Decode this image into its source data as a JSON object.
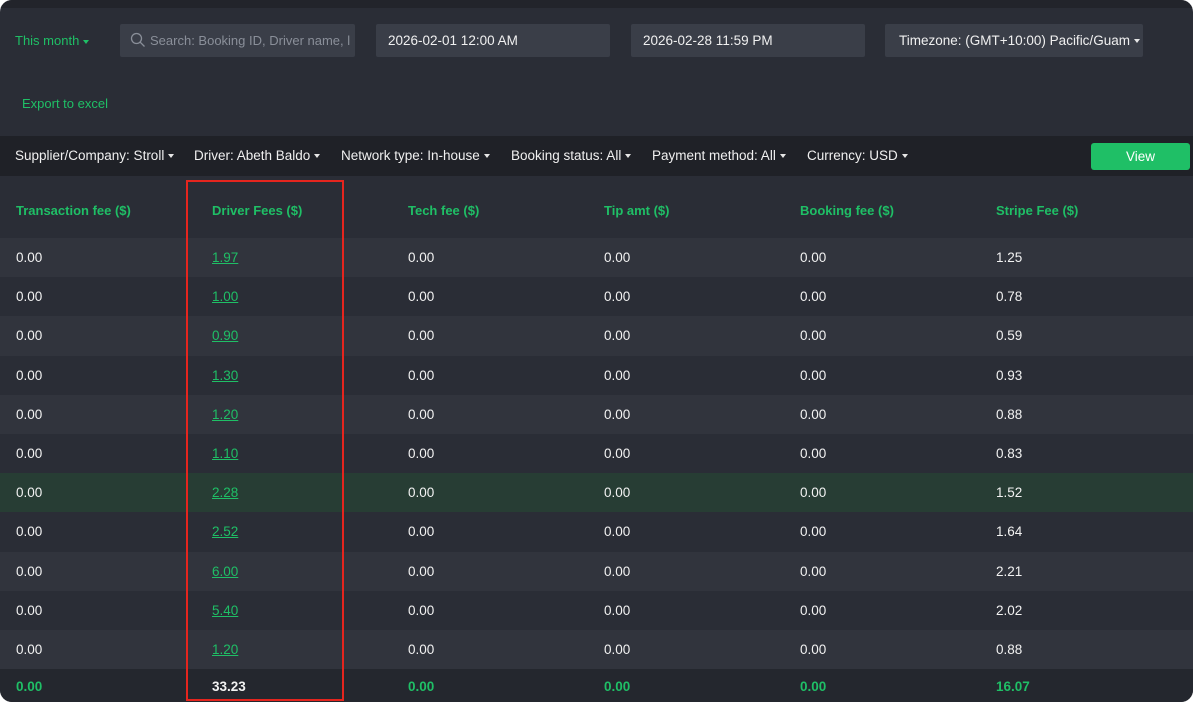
{
  "filters": {
    "period": "This month",
    "search_placeholder": "Search: Booking ID, Driver name, l",
    "start_date": "2026-02-01 12:00 AM",
    "end_date": "2026-02-28 11:59 PM",
    "timezone": "Timezone: (GMT+10:00) Pacific/Guam",
    "export_label": "Export to excel"
  },
  "filter_bar": {
    "supplier": "Supplier/Company: Stroll",
    "driver": "Driver: Abeth Baldo",
    "network": "Network type: In-house",
    "booking_status": "Booking status: All",
    "payment_method": "Payment method: All",
    "currency": "Currency: USD",
    "view_label": "View"
  },
  "table": {
    "headers": [
      "Transaction fee ($)",
      "Driver Fees ($)",
      "Tech fee ($)",
      "Tip amt ($)",
      "Booking fee ($)",
      "Stripe Fee ($)"
    ],
    "rows": [
      [
        "0.00",
        "1.97",
        "0.00",
        "0.00",
        "0.00",
        "1.25"
      ],
      [
        "0.00",
        "1.00",
        "0.00",
        "0.00",
        "0.00",
        "0.78"
      ],
      [
        "0.00",
        "0.90",
        "0.00",
        "0.00",
        "0.00",
        "0.59"
      ],
      [
        "0.00",
        "1.30",
        "0.00",
        "0.00",
        "0.00",
        "0.93"
      ],
      [
        "0.00",
        "1.20",
        "0.00",
        "0.00",
        "0.00",
        "0.88"
      ],
      [
        "0.00",
        "1.10",
        "0.00",
        "0.00",
        "0.00",
        "0.83"
      ],
      [
        "0.00",
        "2.28",
        "0.00",
        "0.00",
        "0.00",
        "1.52"
      ],
      [
        "0.00",
        "2.52",
        "0.00",
        "0.00",
        "0.00",
        "1.64"
      ],
      [
        "0.00",
        "6.00",
        "0.00",
        "0.00",
        "0.00",
        "2.21"
      ],
      [
        "0.00",
        "5.40",
        "0.00",
        "0.00",
        "0.00",
        "2.02"
      ],
      [
        "0.00",
        "1.20",
        "0.00",
        "0.00",
        "0.00",
        "0.88"
      ]
    ],
    "totals": [
      "0.00",
      "33.23",
      "0.00",
      "0.00",
      "0.00",
      "16.07"
    ]
  },
  "colors": {
    "accent": "#1fbf66",
    "highlight_box": "#e5251e",
    "background": "#2a2d36"
  }
}
